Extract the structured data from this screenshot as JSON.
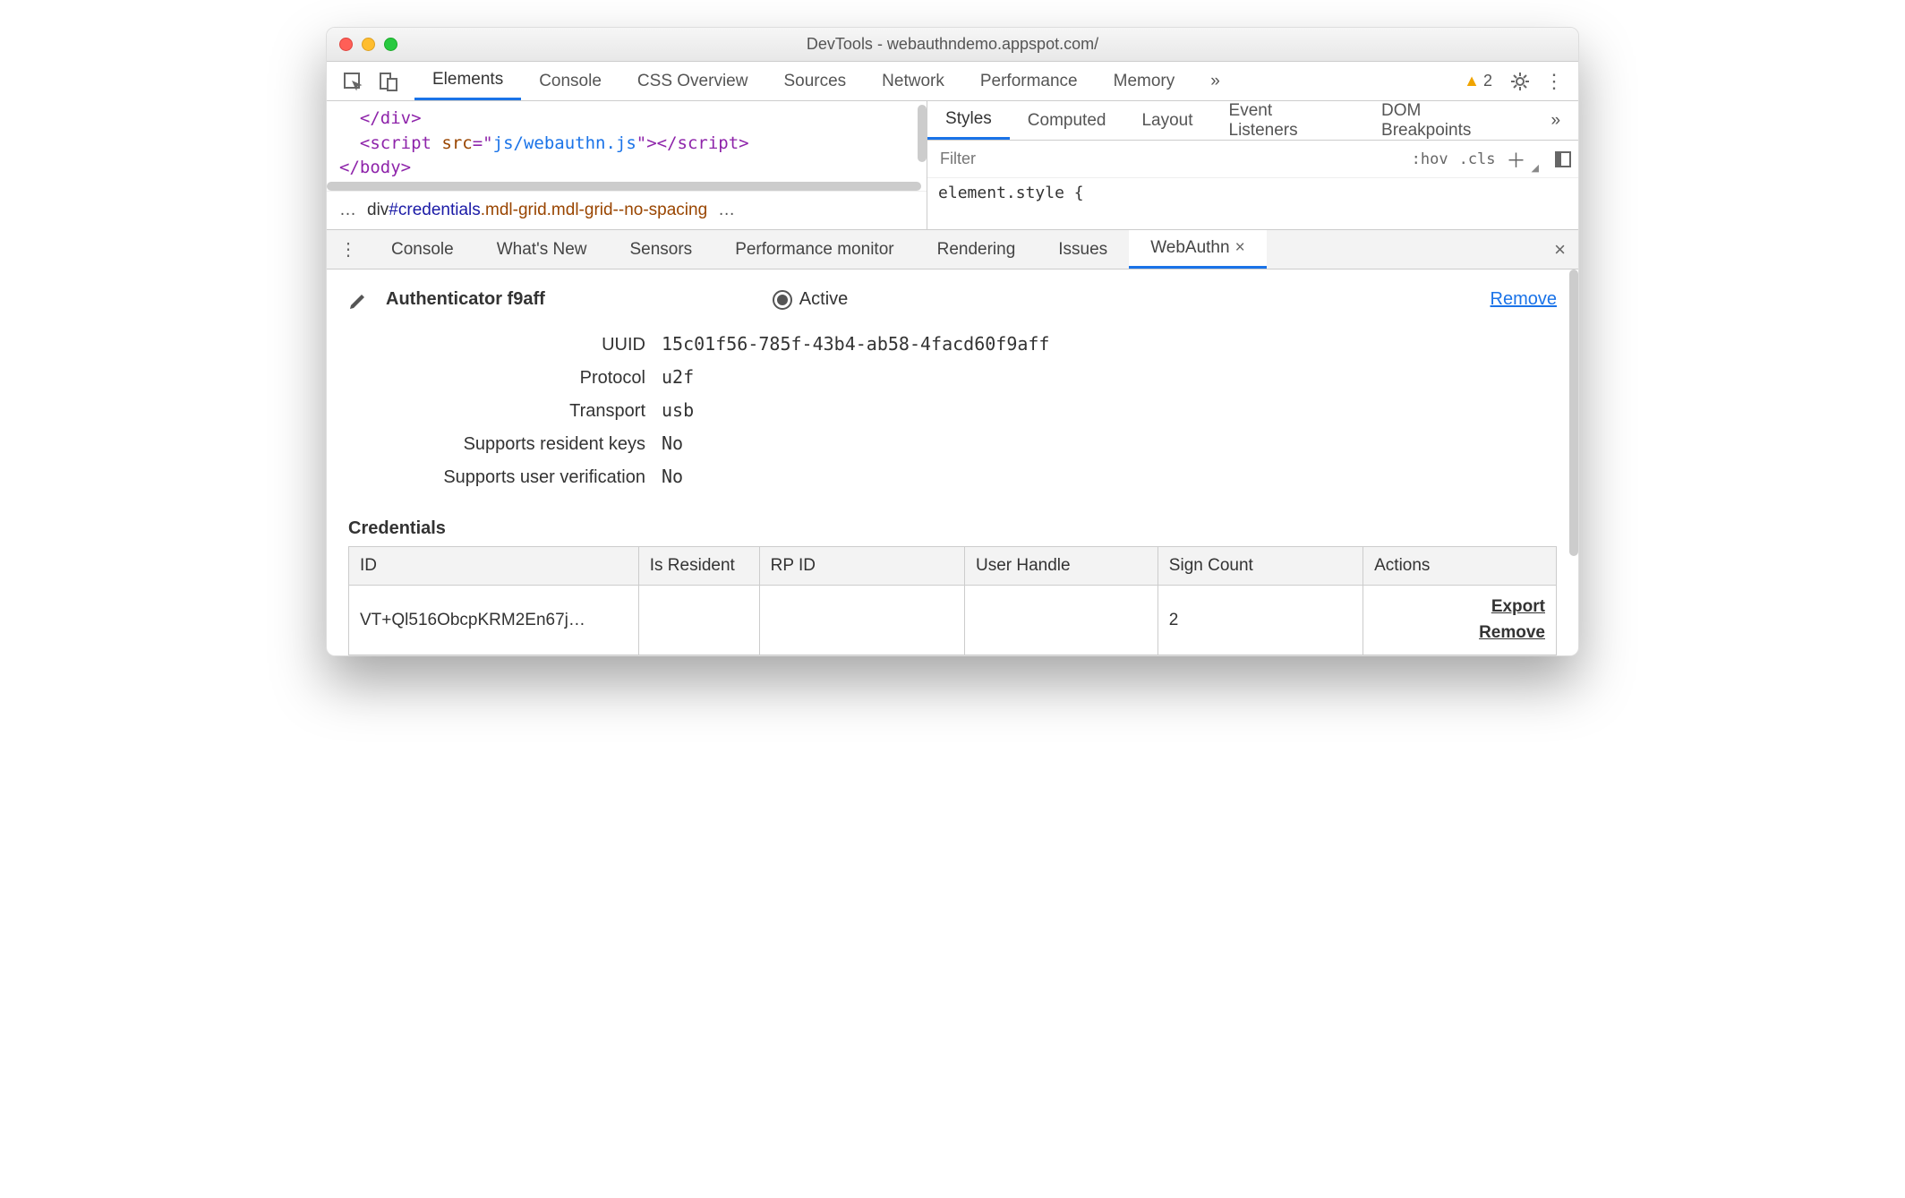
{
  "window": {
    "title": "DevTools - webauthndemo.appspot.com/"
  },
  "mainTabs": {
    "items": [
      "Elements",
      "Console",
      "CSS Overview",
      "Sources",
      "Network",
      "Performance",
      "Memory"
    ],
    "activeIndex": 0
  },
  "warnings": {
    "count": "2"
  },
  "code": {
    "l1": "</div>",
    "l2a": "<script ",
    "l2b": "src",
    "l2c": "=\"",
    "l2d": "js/webauthn.js",
    "l2e": "\"></​script>",
    "l3": "</body>"
  },
  "breadcrumb": {
    "ell1": "…",
    "tag": "div",
    "id": "#credentials",
    "cls": ".mdl-grid.mdl-grid--no-spacing",
    "ell2": "…"
  },
  "stylesTabs": {
    "items": [
      "Styles",
      "Computed",
      "Layout",
      "Event Listeners",
      "DOM Breakpoints"
    ],
    "activeIndex": 0
  },
  "filter": {
    "placeholder": "Filter",
    "hov": ":hov",
    "cls": ".cls"
  },
  "styleBlock": "element.style {",
  "drawerTabs": {
    "items": [
      "Console",
      "What's New",
      "Sensors",
      "Performance monitor",
      "Rendering",
      "Issues",
      "WebAuthn"
    ],
    "activeIndex": 6
  },
  "authenticator": {
    "title": "Authenticator f9aff",
    "activeLabel": "Active",
    "removeLabel": "Remove",
    "props": [
      {
        "label": "UUID",
        "value": "15c01f56-785f-43b4-ab58-4facd60f9aff"
      },
      {
        "label": "Protocol",
        "value": "u2f"
      },
      {
        "label": "Transport",
        "value": "usb"
      },
      {
        "label": "Supports resident keys",
        "value": "No"
      },
      {
        "label": "Supports user verification",
        "value": "No"
      }
    ]
  },
  "credentials": {
    "title": "Credentials",
    "headers": [
      "ID",
      "Is Resident",
      "RP ID",
      "User Handle",
      "Sign Count",
      "Actions"
    ],
    "row": {
      "id": "VT+Ql516ObcpKRM2En67j…",
      "isResident": "",
      "rpId": "",
      "userHandle": "",
      "signCount": "2",
      "export": "Export",
      "remove": "Remove"
    }
  }
}
